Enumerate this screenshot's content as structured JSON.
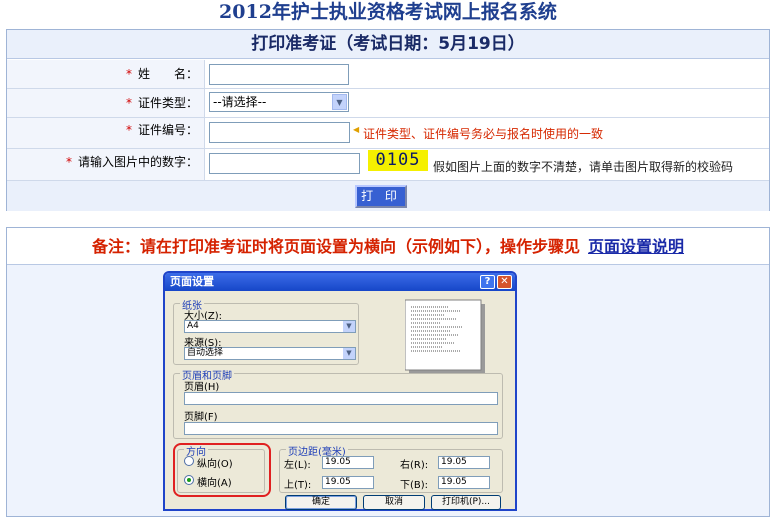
{
  "site": {
    "title": "2012年护士执业资格考试网上报名系统"
  },
  "form_panel": {
    "header": "打印准考证（考试日期：5月19日）",
    "rows": [
      {
        "label": "姓　　名："
      },
      {
        "label": "证件类型：",
        "select_value": "--请选择--"
      },
      {
        "label": "证件编号：",
        "hint": "证件类型、证件编号务必与报名时使用的一致"
      },
      {
        "label": "请输入图片中的数字：",
        "captcha": "0105",
        "hint": "假如图片上面的数字不清楚，请单击图片取得新的校验码"
      }
    ],
    "required_mark": "*",
    "print_button": "打 印"
  },
  "note_panel": {
    "text": "备注：请在打印准考证时将页面设置为横向（示例如下），操作步骤见",
    "link": "页面设置说明"
  },
  "dialog": {
    "title": "页面设置",
    "paper_group": "纸张",
    "size_label": "大小(Z):",
    "size_value": "A4",
    "source_label": "来源(S):",
    "source_value": "自动选择",
    "header_footer_group": "页眉和页脚",
    "header_label": "页眉(H)",
    "footer_label": "页脚(F)",
    "orientation_group": "方向",
    "portrait": "纵向(O)",
    "landscape": "横向(A)",
    "margins_group": "页边距(毫米)",
    "left_label": "左(L):",
    "left_value": "19.05",
    "right_label": "右(R):",
    "right_value": "19.05",
    "top_label": "上(T):",
    "top_value": "19.05",
    "bottom_label": "下(B):",
    "bottom_value": "19.05",
    "ok": "确定",
    "cancel": "取消",
    "printer": "打印机(P)..."
  },
  "colors": {
    "title": "#1f3f8f",
    "required": "#d00000",
    "note": "#d52200",
    "link": "#1a2aa8",
    "captcha_bg": "#f5f000"
  },
  "icons": {
    "hint_arrow": "triangle-left-icon",
    "help": "question-icon",
    "close": "close-icon"
  }
}
